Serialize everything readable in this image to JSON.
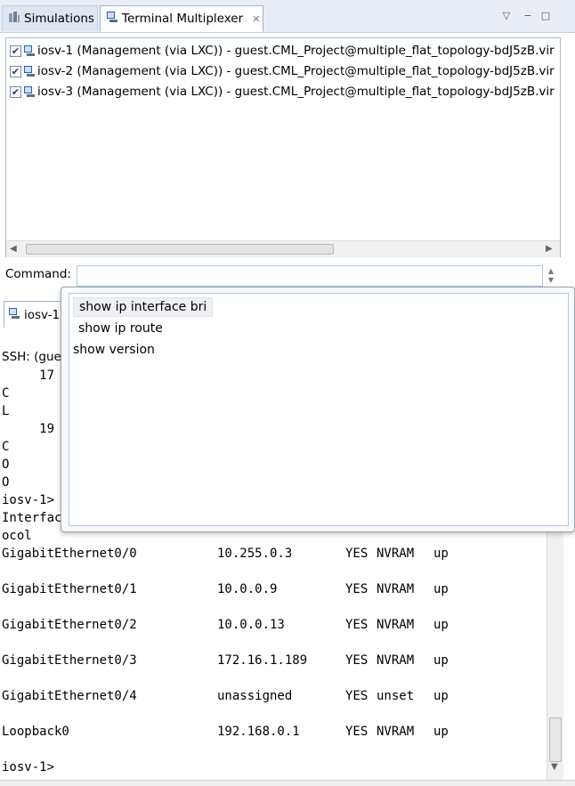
{
  "tabs": {
    "simulations": "Simulations",
    "terminal_multiplexer": "Terminal Multiplexer"
  },
  "window_controls": {
    "menu": "▽",
    "minimize": "−",
    "maximize": "□"
  },
  "sessions": [
    {
      "checked": true,
      "label": "iosv-1  (Management (via LXC)) - guest.CML_Project@multiple_flat_topology-bdJ5zB.vir"
    },
    {
      "checked": true,
      "label": "iosv-2  (Management (via LXC)) - guest.CML_Project@multiple_flat_topology-bdJ5zB.vir"
    },
    {
      "checked": true,
      "label": "iosv-3  (Management (via LXC)) - guest.CML_Project@multiple_flat_topology-bdJ5zB.vir"
    }
  ],
  "command": {
    "label": "Command:",
    "value": ""
  },
  "lower_tab": "iosv-1",
  "ssh_label": "SSH: (gues",
  "terminal_fragments": [
    "     17",
    "C",
    "L",
    "     19",
    "C",
    "O",
    "O",
    "iosv-1>",
    "Interfac",
    "ocol"
  ],
  "interfaces": [
    {
      "name": "GigabitEthernet0/0",
      "ip": "10.255.0.3",
      "ok": "YES",
      "method": "NVRAM",
      "status": "up"
    },
    {
      "name": "GigabitEthernet0/1",
      "ip": "10.0.0.9",
      "ok": "YES",
      "method": "NVRAM",
      "status": "up"
    },
    {
      "name": "GigabitEthernet0/2",
      "ip": "10.0.0.13",
      "ok": "YES",
      "method": "NVRAM",
      "status": "up"
    },
    {
      "name": "GigabitEthernet0/3",
      "ip": "172.16.1.189",
      "ok": "YES",
      "method": "NVRAM",
      "status": "up"
    },
    {
      "name": "GigabitEthernet0/4",
      "ip": "unassigned",
      "ok": "YES",
      "method": "unset",
      "status": "up"
    },
    {
      "name": "Loopback0",
      "ip": "192.168.0.1",
      "ok": "YES",
      "method": "NVRAM",
      "status": "up"
    }
  ],
  "prompt": "iosv-1>",
  "suggestions": [
    {
      "label": "show ip interface bri",
      "selected": true
    },
    {
      "label": "show ip route",
      "selected": false
    },
    {
      "label": "show version",
      "selected": false
    }
  ],
  "colors": {
    "accent": "#9fb3cc",
    "icon_blue": "#2a5db0"
  }
}
